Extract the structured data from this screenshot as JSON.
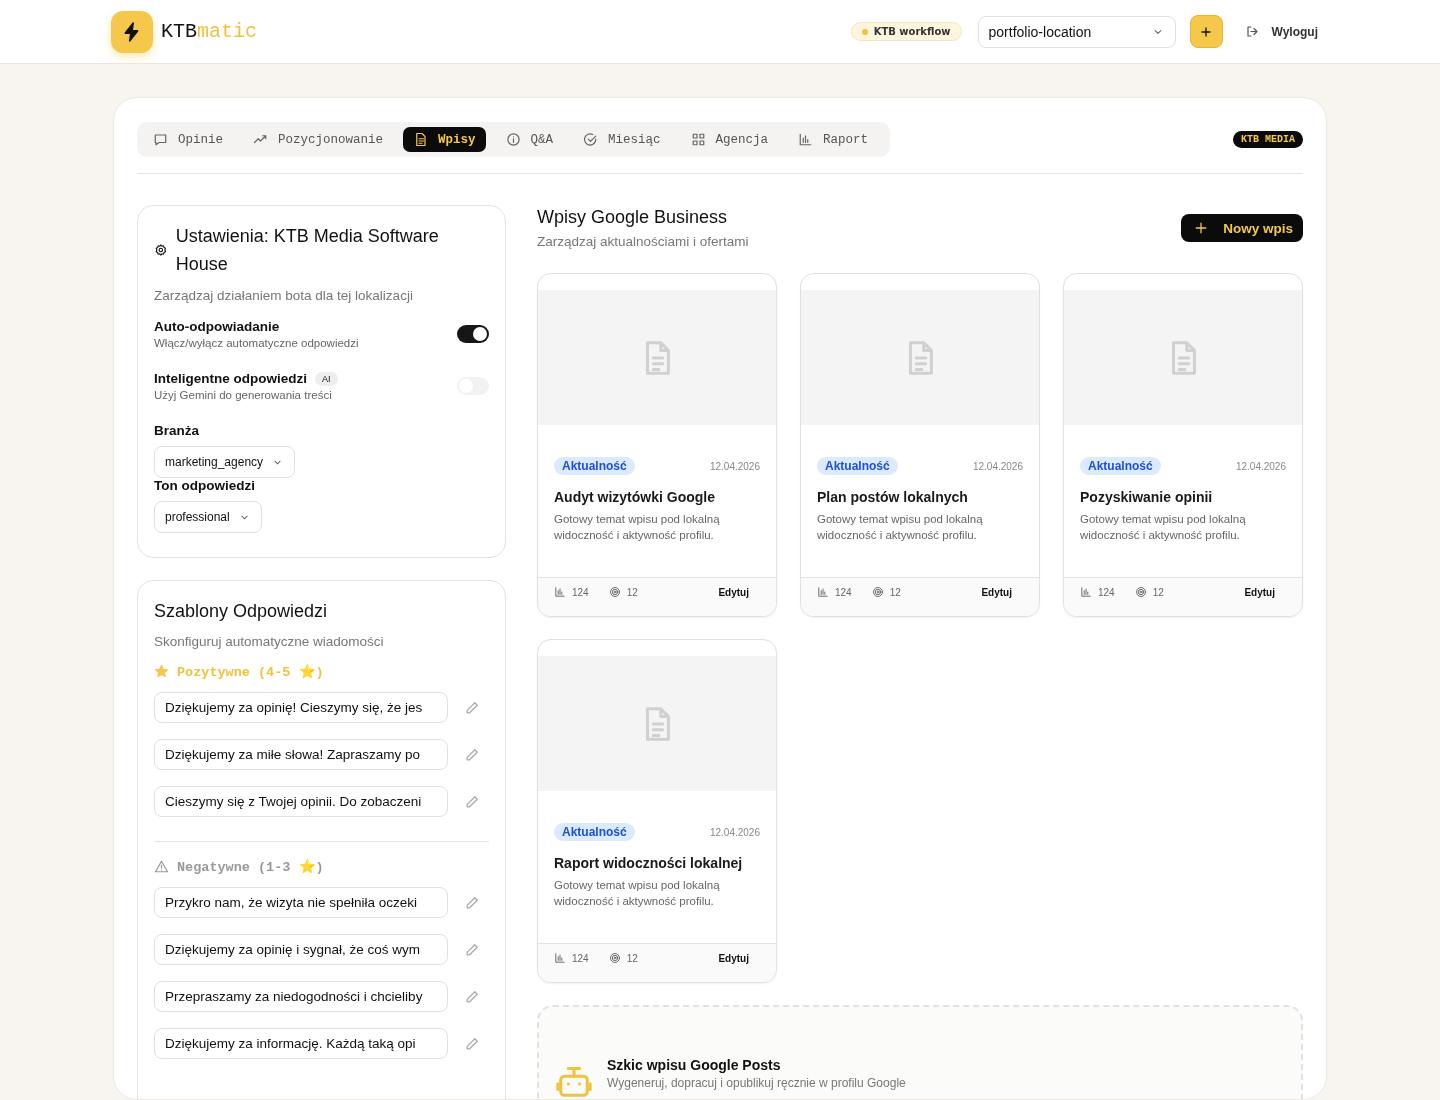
{
  "header": {
    "logo_text": "KTB",
    "logo_accent": "matic",
    "workflow_badge": "KTB workflow",
    "location_select": "portfolio-location",
    "logout": "Wyloguj"
  },
  "tabs": [
    {
      "label": "Opinie",
      "selected": false
    },
    {
      "label": "Pozycjonowanie",
      "selected": false
    },
    {
      "label": "Wpisy",
      "selected": true
    },
    {
      "label": "Q&A",
      "selected": false
    },
    {
      "label": "Miesiąc",
      "selected": false
    },
    {
      "label": "Agencja",
      "selected": false
    },
    {
      "label": "Raport",
      "selected": false
    }
  ],
  "brand_badge": "KTB MEDIA",
  "settings": {
    "title": "Ustawienia: KTB Media Software House",
    "subtitle": "Zarządzaj działaniem bota dla tej lokalizacji",
    "toggles": [
      {
        "label": "Auto-odpowiadanie",
        "description": "Włącz/wyłącz automatyczne odpowiedzi",
        "on": true,
        "disabled": false
      },
      {
        "label": "Inteligentne odpowiedzi",
        "badge": "AI",
        "description": "Użyj Gemini do generowania treści",
        "on": false,
        "disabled": true
      }
    ],
    "selects": [
      {
        "label": "Branża",
        "value": "marketing_agency"
      },
      {
        "label": "Ton odpowiedzi",
        "value": "professional"
      }
    ]
  },
  "templates": {
    "title": "Szablony Odpowiedzi",
    "subtitle": "Skonfiguruj automatyczne wiadomości",
    "groups": [
      {
        "kind": "positive",
        "label": "Pozytywne (4-5 ⭐)",
        "items": [
          "Dziękujemy za opinię! Cieszymy się, że jes",
          "Dziękujemy za miłe słowa! Zapraszamy po",
          "Cieszymy się z Twojej opinii. Do zobaczeni"
        ]
      },
      {
        "kind": "negative",
        "label": "Negatywne (1-3 ⭐)",
        "items": [
          "Przykro nam, że wizyta nie spełniła oczeki",
          "Dziękujemy za opinię i sygnał, że coś wym",
          "Przepraszamy za niedogodności i chcieliby",
          "Dziękujemy za informację. Każdą taką opi"
        ]
      }
    ]
  },
  "posts": {
    "title": "Wpisy Google Business",
    "subtitle": "Zarządzaj aktualnościami i ofertami",
    "new_button": "Nowy wpis",
    "items": [
      {
        "tag": "Aktualność",
        "date": "12.04.2026",
        "title": "Audyt wizytówki Google",
        "description": "Gotowy temat wpisu pod lokalną widoczność i aktywność profilu.",
        "views": "124",
        "clicks": "12",
        "edit": "Edytuj"
      },
      {
        "tag": "Aktualność",
        "date": "12.04.2026",
        "title": "Plan postów lokalnych",
        "description": "Gotowy temat wpisu pod lokalną widoczność i aktywność profilu.",
        "views": "124",
        "clicks": "12",
        "edit": "Edytuj"
      },
      {
        "tag": "Aktualność",
        "date": "12.04.2026",
        "title": "Pozyskiwanie opinii",
        "description": "Gotowy temat wpisu pod lokalną widoczność i aktywność profilu.",
        "views": "124",
        "clicks": "12",
        "edit": "Edytuj"
      },
      {
        "tag": "Aktualność",
        "date": "12.04.2026",
        "title": "Raport widoczności lokalnej",
        "description": "Gotowy temat wpisu pod lokalną widoczność i aktywność profilu.",
        "views": "124",
        "clicks": "12",
        "edit": "Edytuj"
      }
    ]
  },
  "draft": {
    "title": "Szkic wpisu Google Posts",
    "subtitle": "Wygeneruj, dopracuj i opublikuj ręcznie w profilu Google"
  }
}
